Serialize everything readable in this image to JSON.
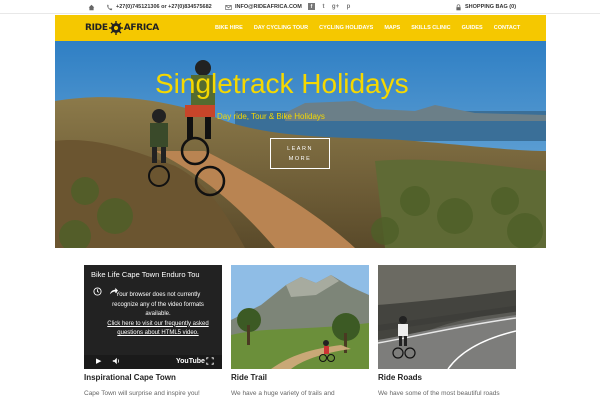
{
  "topbar": {
    "phone": "+27(0)745121306 or +27(0)834575682",
    "email": "INFO@RIDEAFRICA.COM",
    "socials": [
      "f",
      "t",
      "g+",
      "p"
    ],
    "shopping_bag": "SHOPPING BAG (0)"
  },
  "nav": {
    "logo_left": "RIDE",
    "logo_right": "AFRICA",
    "items": [
      "BIKE HIRE",
      "DAY CYCLING TOUR",
      "CYCLING HOLIDAYS",
      "MAPS",
      "SKILLS CLINIC",
      "GUIDES",
      "CONTACT"
    ],
    "bar_color": "#f5c800"
  },
  "hero": {
    "title": "Singletrack Holidays",
    "subtitle": "Day ride, Tour & Bike Holidays",
    "button_line1": "LEARN",
    "button_line2": "MORE",
    "accent": "#f5d800"
  },
  "cards": [
    {
      "video_title": "Bike Life Cape Town Enduro Tou",
      "message_line1": "Your browser does not currently",
      "message_line2": "recognize any of the video formats",
      "message_line3": "available.",
      "link_line1": "Click here to visit our frequently asked",
      "link_line2": "questions about HTML5 video.",
      "player_brand": "YouTube",
      "title": "Inspirational Cape Town",
      "text": "Cape Town will surprise and inspire you!"
    },
    {
      "title": "Ride Trail",
      "text": "We have a huge variety of trails and"
    },
    {
      "title": "Ride Roads",
      "text": "We have some of the most beautiful roads"
    }
  ]
}
